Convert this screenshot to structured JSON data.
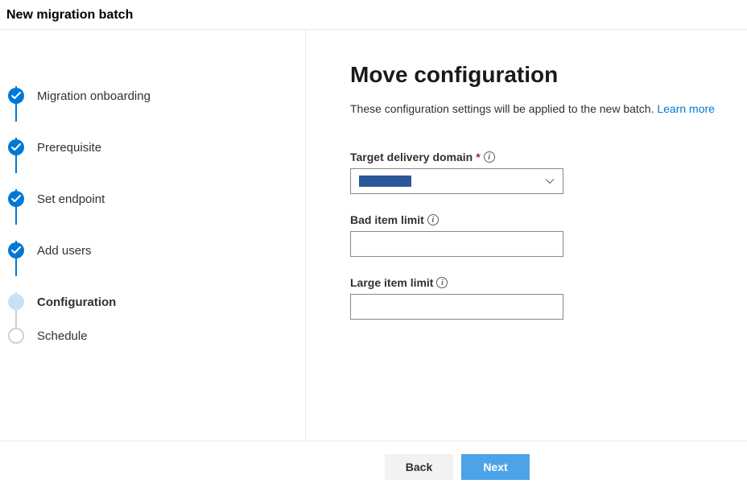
{
  "header": {
    "title": "New migration batch"
  },
  "stepper": {
    "items": [
      {
        "label": "Migration onboarding",
        "state": "done"
      },
      {
        "label": "Prerequisite",
        "state": "done"
      },
      {
        "label": "Set endpoint",
        "state": "done"
      },
      {
        "label": "Add users",
        "state": "done"
      },
      {
        "label": "Configuration",
        "state": "current"
      },
      {
        "label": "Schedule",
        "state": "upcoming"
      }
    ]
  },
  "main": {
    "heading": "Move configuration",
    "subtitle_pre": "These configuration settings will be applied to the new batch. ",
    "learn_more_text": "Learn more",
    "fields": {
      "target_domain": {
        "label": "Target delivery domain",
        "required_mark": "*",
        "selected": ""
      },
      "bad_item_limit": {
        "label": "Bad item limit",
        "value": ""
      },
      "large_item_limit": {
        "label": "Large item limit",
        "value": ""
      }
    }
  },
  "footer": {
    "back_label": "Back",
    "next_label": "Next"
  }
}
